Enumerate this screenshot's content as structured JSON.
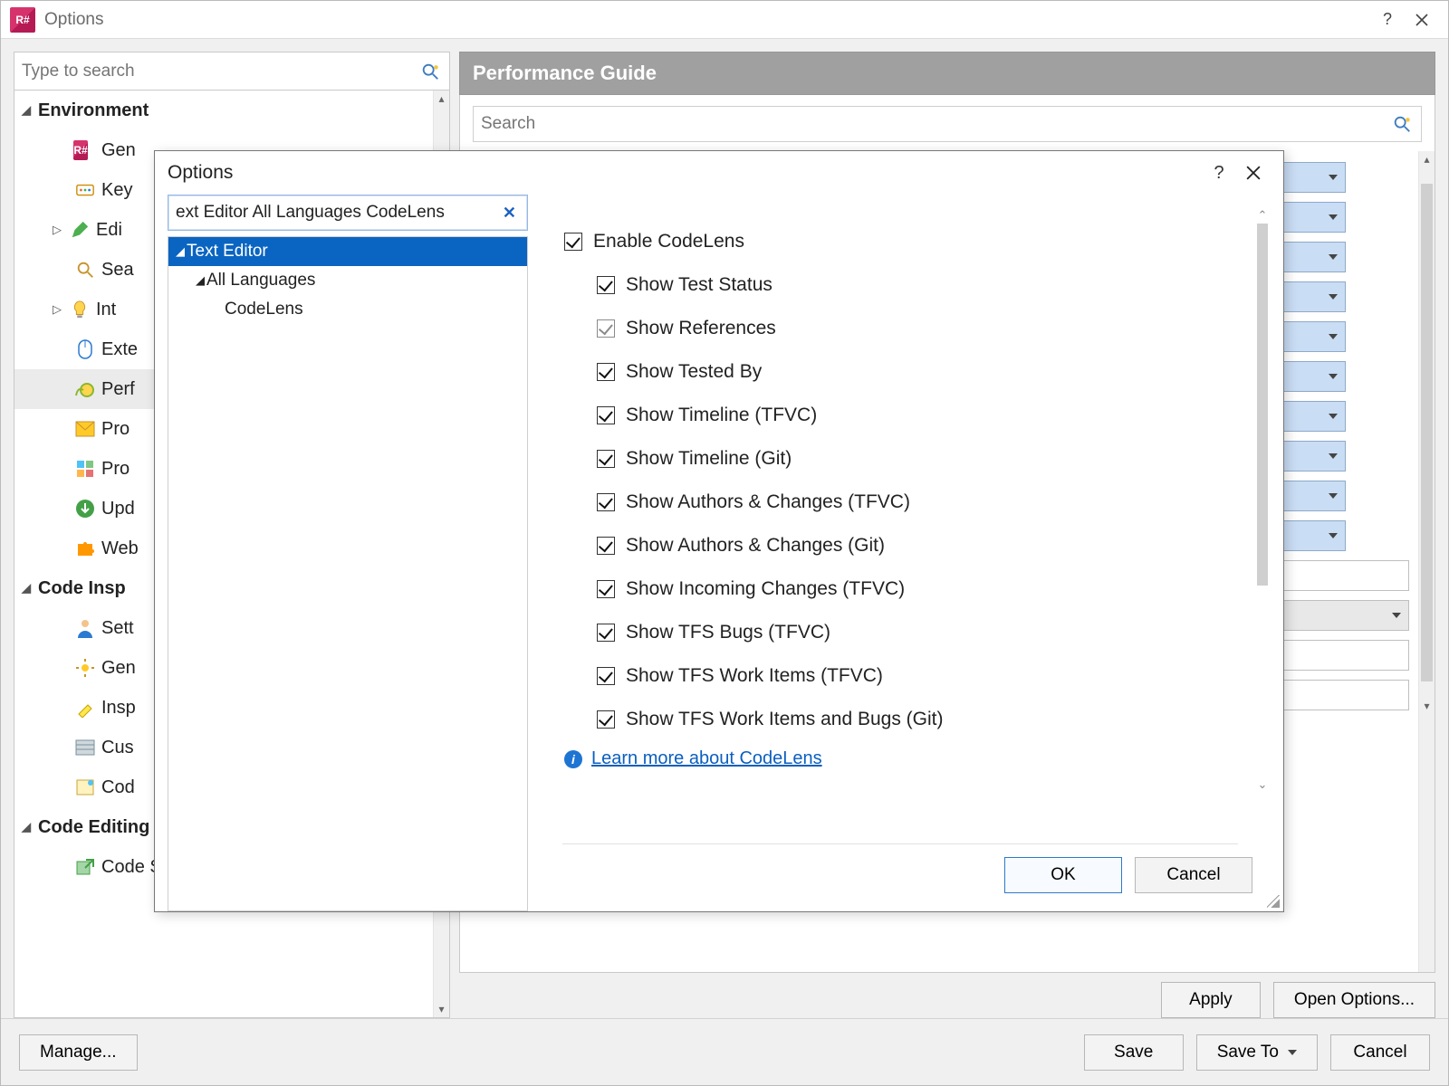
{
  "main": {
    "title": "Options",
    "search_placeholder": "Type to search",
    "perf_header": "Performance Guide",
    "perf_search_placeholder": "Search",
    "apply": "Apply",
    "open_options": "Open Options...",
    "manage": "Manage...",
    "save": "Save",
    "save_to": "Save To",
    "cancel": "Cancel",
    "tree": {
      "env": "Environment",
      "items": [
        {
          "label": "Gen",
          "icon": "rs"
        },
        {
          "label": "Key",
          "icon": "keys"
        },
        {
          "label": "Edi",
          "icon": "pencil",
          "has_children": true
        },
        {
          "label": "Sea",
          "icon": "magnifier"
        },
        {
          "label": "Int",
          "icon": "bulb",
          "has_children": true
        },
        {
          "label": "Exte",
          "icon": "mouse"
        },
        {
          "label": "Perf",
          "icon": "snail",
          "selected": true
        },
        {
          "label": "Pro",
          "icon": "mail"
        },
        {
          "label": "Pro",
          "icon": "grid"
        },
        {
          "label": "Upd",
          "icon": "download"
        },
        {
          "label": "Web",
          "icon": "puzzle"
        }
      ],
      "code_insp": "Code Insp",
      "insp_items": [
        {
          "label": "Sett",
          "icon": "person"
        },
        {
          "label": "Gen",
          "icon": "gear"
        },
        {
          "label": "Insp",
          "icon": "highlight"
        },
        {
          "label": "Cus",
          "icon": "pattern"
        },
        {
          "label": "Cod",
          "icon": "notes"
        }
      ],
      "code_edit": "Code Editing",
      "edit_items": [
        {
          "label": "Code Style Sharing",
          "icon": "share"
        }
      ]
    }
  },
  "inner": {
    "title": "Options",
    "filter_text": "ext Editor All Languages CodeLens",
    "tree": {
      "root": "Text Editor",
      "child": "All Languages",
      "leaf": "CodeLens"
    },
    "checks": {
      "enable": "Enable CodeLens",
      "items": [
        {
          "label": "Show Test Status",
          "checked": true
        },
        {
          "label": "Show References",
          "checked": true,
          "greyed": true
        },
        {
          "label": "Show Tested By",
          "checked": true
        },
        {
          "label": "Show Timeline (TFVC)",
          "checked": true
        },
        {
          "label": "Show Timeline (Git)",
          "checked": true
        },
        {
          "label": "Show Authors & Changes (TFVC)",
          "checked": true
        },
        {
          "label": "Show Authors & Changes (Git)",
          "checked": true
        },
        {
          "label": "Show Incoming Changes (TFVC)",
          "checked": true
        },
        {
          "label": "Show TFS Bugs (TFVC)",
          "checked": true
        },
        {
          "label": "Show TFS Work Items (TFVC)",
          "checked": true
        },
        {
          "label": "Show TFS Work Items and Bugs (Git)",
          "checked": true
        }
      ]
    },
    "learn_more": "Learn more about CodeLens",
    "ok": "OK",
    "cancel": "Cancel"
  }
}
